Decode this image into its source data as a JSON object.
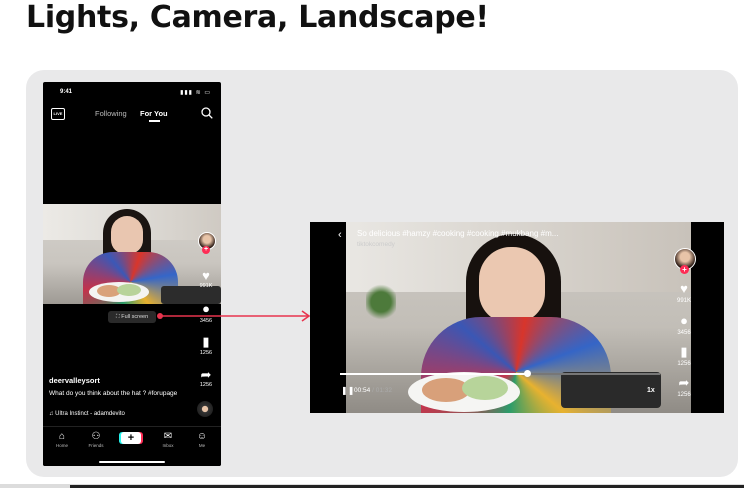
{
  "headline": "Lights, Camera, Landscape!",
  "phone": {
    "status": {
      "time": "9:41",
      "icons": "▮▮▮ ≋ ▭"
    },
    "live_label": "LIVE",
    "tabs": {
      "following": "Following",
      "foryou": "For You"
    },
    "side": {
      "likes": "991K",
      "comments": "3456",
      "saves": "1256",
      "shares": "1256"
    },
    "fullscreen_label": "⛶ Full screen",
    "username": "deervalleysort",
    "caption": "What do you think about the hat ? #forupage",
    "music": "♫ Ultra Instinct - adamdevito",
    "nav": {
      "home": "Home",
      "friends": "Friends",
      "inbox": "Inbox",
      "me": "Me"
    }
  },
  "landscape": {
    "title": "So delicious #hamzy #cooking #cooking #mukbang #m...",
    "author": "tiktokcomedy",
    "time_current": "00:54",
    "time_sep": " / ",
    "time_total": "01:32",
    "speed": "1x",
    "progress": 0.587,
    "side": {
      "likes": "991K",
      "comments": "3456",
      "saves": "1256",
      "shares": "1256"
    }
  },
  "colors": {
    "accent": "#fe2c55",
    "cyan": "#25f4ee",
    "arrow": "#e8344e",
    "panel": "#e9e9ea"
  }
}
